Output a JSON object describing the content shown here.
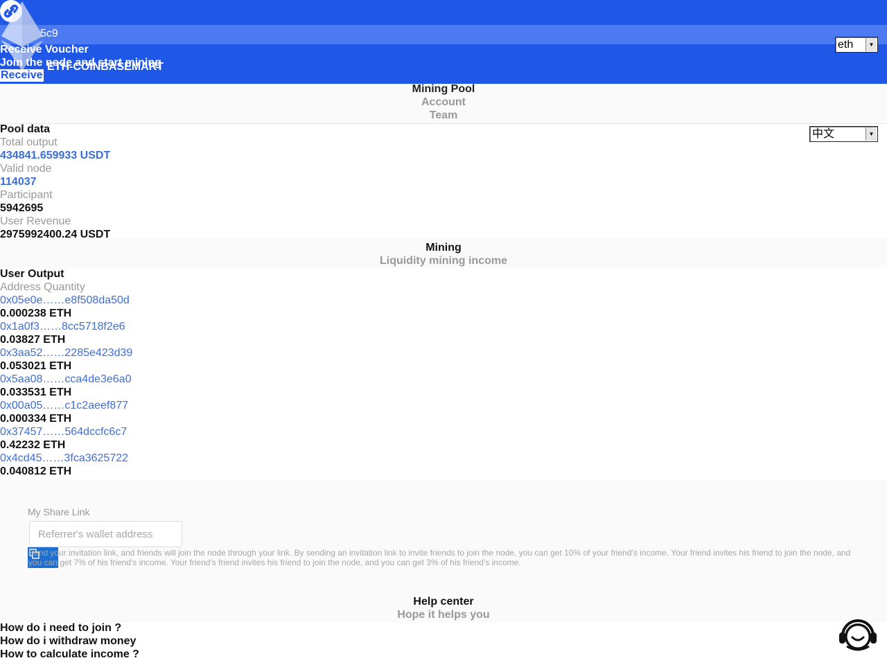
{
  "header": {
    "address": "5c9",
    "receive_voucher": "Receive Voucher",
    "join_text": "Join the node and start mining",
    "brand": "ETH-COINBASEMART",
    "receive_button": "Receive",
    "currency_select": "eth",
    "language_select": "中文"
  },
  "tabs": [
    {
      "label": "Mining Pool"
    },
    {
      "label": "Account"
    },
    {
      "label": "Team"
    }
  ],
  "pool": {
    "title": "Pool data",
    "total_output_label": "Total output",
    "total_output_value": "434841.659933 USDT",
    "valid_node_label": "Valid node",
    "valid_node_value": "114037",
    "participant_label": "Participant",
    "participant_value": "5942695",
    "user_revenue_label": "User Revenue",
    "user_revenue_value": "2975992400.24 USDT"
  },
  "mining": {
    "title": "Mining",
    "subtitle": "Liquidity mining income"
  },
  "user_output": {
    "title": "User Output",
    "columns_label": "Address Quantity",
    "rows": [
      {
        "address": "0x05e0e……e8f508da50d",
        "quantity": "0.000238 ETH"
      },
      {
        "address": "0x1a0f3……8cc5718f2e6",
        "quantity": "0.03827 ETH"
      },
      {
        "address": "0x3aa52……2285e423d39",
        "quantity": "0.053021 ETH"
      },
      {
        "address": "0x5aa08……cca4de3e6a0",
        "quantity": "0.033531 ETH"
      },
      {
        "address": "0x00a05……c1c2aeef877",
        "quantity": "0.000334 ETH"
      },
      {
        "address": "0x37457……564dccfc6c7",
        "quantity": "0.42232 ETH"
      },
      {
        "address": "0x4cd45……3fca3625722",
        "quantity": "0.040812 ETH"
      }
    ]
  },
  "share": {
    "label": "My Share Link",
    "input_placeholder": "Referrer's wallet address",
    "description": "Send your invitation link, and friends will join the node through your link. By sending an invitation link to invite friends to join the node, you can get 10% of your friend's income. Your friend invites his friend to join the node, and you can get 7% of his friend's income. Your friend's friend invites his friend to join the node, and you can get 3% of his friend's income."
  },
  "help": {
    "title": "Help center",
    "subtitle": "Hope it helps you",
    "faq": [
      {
        "q": "How do i need to join ?"
      },
      {
        "q": "How do i withdraw money"
      },
      {
        "q": "How to calculate income ?"
      }
    ]
  },
  "icons": {
    "logo": "chain-link-icon",
    "eth": "ethereum-diamond-icon",
    "copy": "copy-icon",
    "support": "customer-support-icon"
  },
  "colors": {
    "header_bg": "#1f57e7",
    "link_blue": "#3b6fd8",
    "copy_button": "#1e6fcf"
  }
}
